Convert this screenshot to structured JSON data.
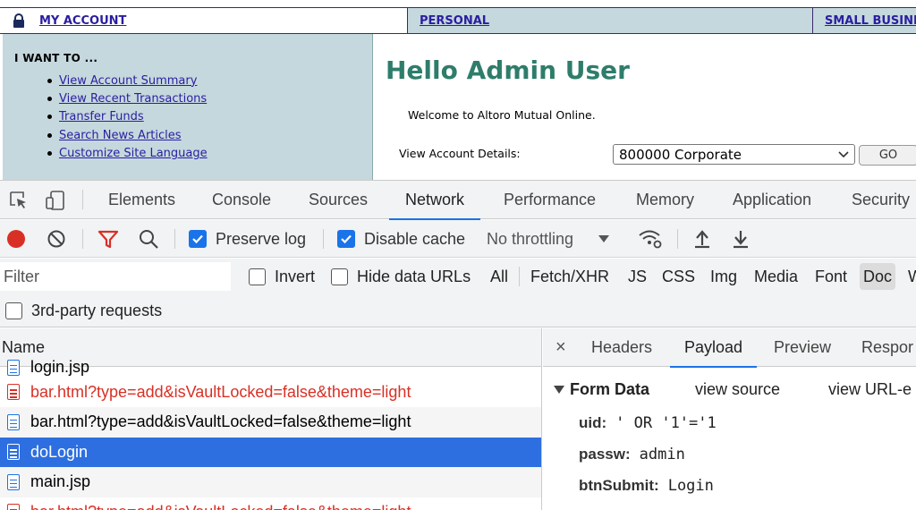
{
  "site": {
    "nav": {
      "my_account": "MY ACCOUNT",
      "personal": "PERSONAL",
      "small_business": "SMALL BUSINE"
    },
    "sidebar": {
      "heading": "I WANT TO ...",
      "links": [
        "View Account Summary",
        "View Recent Transactions",
        "Transfer Funds",
        "Search News Articles",
        "Customize Site Language"
      ]
    },
    "main": {
      "greeting": "Hello Admin User",
      "welcome": "Welcome to Altoro Mutual Online.",
      "view_details_label": "View Account Details:",
      "account_selected": "800000 Corporate",
      "go_label": "GO"
    }
  },
  "devtools": {
    "tabs": [
      "Elements",
      "Console",
      "Sources",
      "Network",
      "Performance",
      "Memory",
      "Application",
      "Security"
    ],
    "active_tab": "Network",
    "toolbar": {
      "preserve_log": "Preserve log",
      "disable_cache": "Disable cache",
      "throttling": "No throttling"
    },
    "filter": {
      "placeholder": "Filter",
      "invert": "Invert",
      "hide_data_urls": "Hide data URLs",
      "types": [
        "All",
        "Fetch/XHR",
        "JS",
        "CSS",
        "Img",
        "Media",
        "Font",
        "Doc",
        "W"
      ],
      "active_type": "Doc",
      "third_party": "3rd-party requests"
    },
    "requests": {
      "column_name": "Name",
      "rows": [
        {
          "name": "login.jsp",
          "status": "normal"
        },
        {
          "name": "bar.html?type=add&isVaultLocked=false&theme=light",
          "status": "error"
        },
        {
          "name": "bar.html?type=add&isVaultLocked=false&theme=light",
          "status": "normal"
        },
        {
          "name": "doLogin",
          "status": "selected"
        },
        {
          "name": "main.jsp",
          "status": "normal"
        },
        {
          "name": "bar.html?type=add&isVaultLocked=false&theme=light",
          "status": "error"
        }
      ]
    },
    "detail": {
      "close": "×",
      "tabs": [
        "Headers",
        "Payload",
        "Preview",
        "Respor"
      ],
      "active_tab": "Payload",
      "form_data_title": "Form Data",
      "view_source": "view source",
      "view_url": "view URL-e",
      "fields": [
        {
          "key": "uid:",
          "value": "' OR '1'='1"
        },
        {
          "key": "passw:",
          "value": "admin"
        },
        {
          "key": "btnSubmit:",
          "value": "Login"
        }
      ]
    },
    "colors": {
      "accent": "#1a73e8",
      "record": "#d93025",
      "error_text": "#d93025",
      "selected_row": "#2d6fe0"
    }
  }
}
